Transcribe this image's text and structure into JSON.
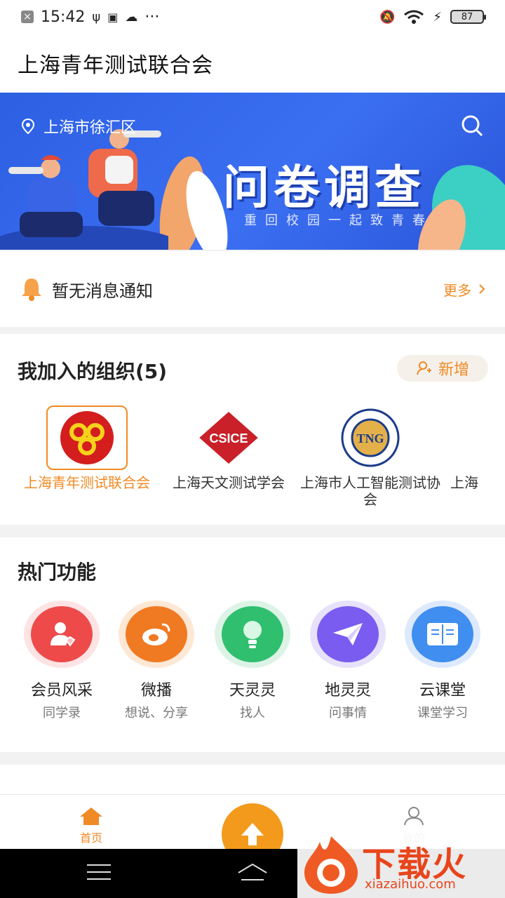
{
  "status_bar": {
    "time": "15:42",
    "dots": "···",
    "battery": "87"
  },
  "title": "上海青年测试联合会",
  "banner": {
    "location": "上海市徐汇区",
    "headline": "问卷调查",
    "subtitle": "重回校园一起致青春"
  },
  "notice": {
    "text": "暂无消息通知",
    "more": "更多"
  },
  "orgs": {
    "title": "我加入的组织(5)",
    "add_label": "新增",
    "items": [
      {
        "name": "上海青年测试联合会",
        "selected": true
      },
      {
        "name": "上海天文测试学会",
        "logo_text": "CSICE"
      },
      {
        "name": "上海市人工智能测试协会",
        "logo_text": "TNG"
      },
      {
        "name": "上海"
      }
    ]
  },
  "hot": {
    "title": "热门功能",
    "items": [
      {
        "label": "会员风采",
        "sub": "同学录",
        "color": "#ee4a4a",
        "icon": "member-icon"
      },
      {
        "label": "微播",
        "sub": "想说、分享",
        "color": "#f07a22",
        "icon": "weibo-icon"
      },
      {
        "label": "天灵灵",
        "sub": "找人",
        "color": "#2fbf6f",
        "icon": "bulb-icon"
      },
      {
        "label": "地灵灵",
        "sub": "问事情",
        "color": "#7a5cf0",
        "icon": "paper-plane-icon"
      },
      {
        "label": "云课堂",
        "sub": "课堂学习",
        "color": "#3f8ef0",
        "icon": "book-icon"
      }
    ]
  },
  "bottom_nav": {
    "home": "首页",
    "me": "我的"
  },
  "watermark": {
    "text": "下载火",
    "sub": "xiazaihuo.com"
  },
  "colors": {
    "accent": "#f08a24",
    "banner_blue": "#2d5fe3"
  }
}
